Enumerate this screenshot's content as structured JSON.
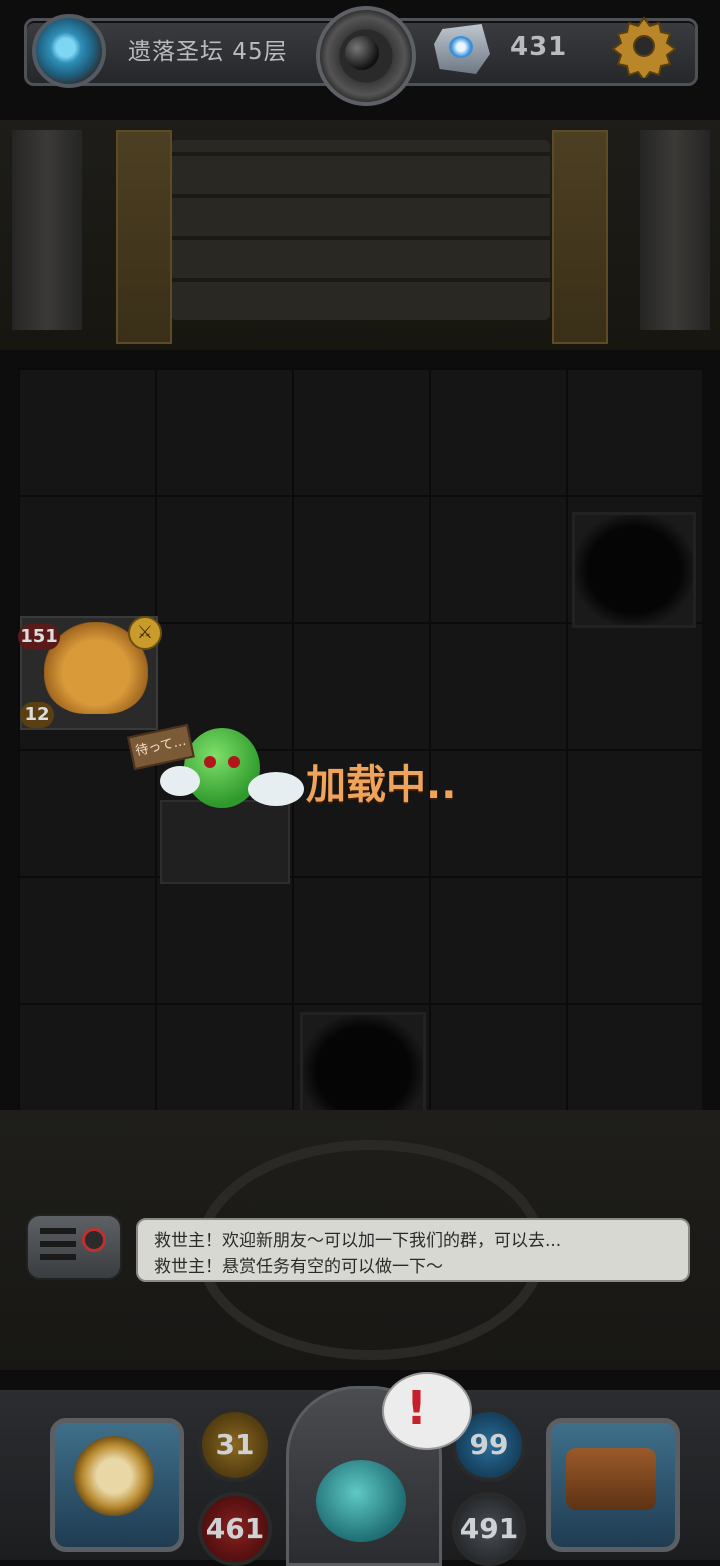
{
  "hud": {
    "floor_label": "遗落圣坛 45层",
    "gem_count": "431",
    "icons": [
      "portal-icon",
      "bomb-icon",
      "crystal-icon",
      "gear-icon"
    ]
  },
  "board": {
    "cat_monster": {
      "hp": "151",
      "atk": "12"
    },
    "player_sign": "待って…",
    "loading_text": "加载中.."
  },
  "chat": {
    "messages": [
      "救世主！欢迎新朋友～可以加一下我们的群，可以去...",
      "救世主！悬赏任务有空的可以做一下～"
    ]
  },
  "stats": {
    "attack": "31",
    "health": "461",
    "defense": "99",
    "mana": "491",
    "alert": "!"
  },
  "colors": {
    "loading": "#f0a35a",
    "background": "#0d0d0d",
    "chat_bg": "#d8d8d2"
  }
}
